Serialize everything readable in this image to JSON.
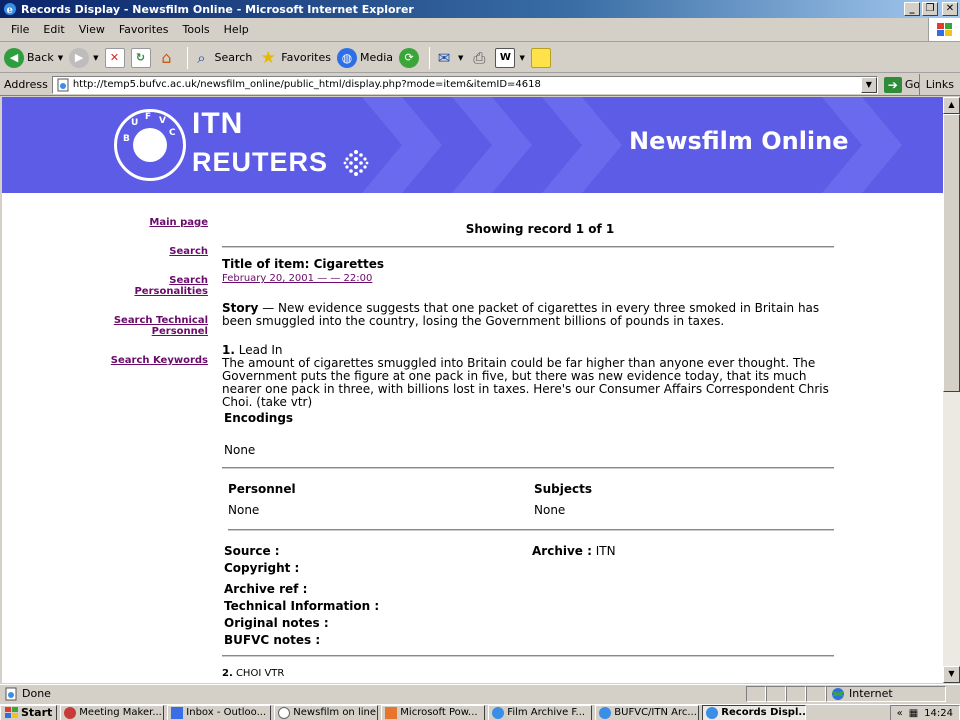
{
  "window": {
    "title": "Records Display - Newsfilm Online - Microsoft Internet Explorer"
  },
  "menu": [
    "File",
    "Edit",
    "View",
    "Favorites",
    "Tools",
    "Help"
  ],
  "toolbar": {
    "back": "Back",
    "search": "Search",
    "favorites": "Favorites",
    "media": "Media"
  },
  "address": {
    "label": "Address",
    "url": "http://temp5.bufvc.ac.uk/newsfilm_online/public_html/display.php?mode=item&itemID=4618",
    "go": "Go",
    "links": "Links"
  },
  "banner": {
    "itn": "ITN",
    "reuters": "REUTERS",
    "site_title": "Newsfilm Online",
    "logo_letters": [
      "B",
      "U",
      "F",
      "V",
      "C"
    ]
  },
  "nav": [
    {
      "label": "Main page"
    },
    {
      "label": "Search"
    },
    {
      "label": "Search Personalities"
    },
    {
      "label": "Search Technical Personnel"
    },
    {
      "label": "Search Keywords"
    }
  ],
  "record": {
    "showing": "Showing record 1 of 1",
    "title": "Title of item: Cigarettes",
    "date": "February 20, 2001 — — 22:00",
    "story_label": "Story",
    "story_text": " — New evidence suggests that one packet of cigarettes in every three smoked in Britain has been smuggled into the country, losing the Government billions of pounds in taxes.",
    "section1_num": "1.",
    "section1_name": " Lead In",
    "section1_text": "The amount of cigarettes smuggled into Britain could be far higher than anyone ever thought. The Government puts the figure at one pack in five, but there was new evidence today, that its much nearer one pack in three, with billions lost in taxes. Here's our Consumer Affairs Correspondent Chris Choi. (take vtr)",
    "encodings_label": "Encodings",
    "encodings_value": "None",
    "personnel_label": "Personnel",
    "personnel_value": "None",
    "subjects_label": "Subjects",
    "subjects_value": "None",
    "source_label": "Source :",
    "archive_label": "Archive :",
    "archive_value": " ITN",
    "copyright_label": "Copyright :",
    "archive_ref_label": "Archive ref :",
    "tech_info_label": "Technical Information :",
    "original_notes_label": "Original notes :",
    "bufvc_notes_label": "BUFVC notes :",
    "section2_num": "2.",
    "section2_name": " CHOI VTR"
  },
  "status": {
    "text": "Done",
    "zone": "Internet"
  },
  "taskbar": {
    "start": "Start",
    "tasks": [
      "Meeting Maker...",
      "Inbox - Outloo...",
      "Newsfilm on line",
      "Microsoft Pow...",
      "Film Archive F...",
      "BUFVC/ITN Arc...",
      "Records Displ..."
    ],
    "clock": "14:24"
  },
  "colors": {
    "banner": "#5c5ce6",
    "link": "#6a0a6a",
    "titlebar": "#0a246a"
  }
}
